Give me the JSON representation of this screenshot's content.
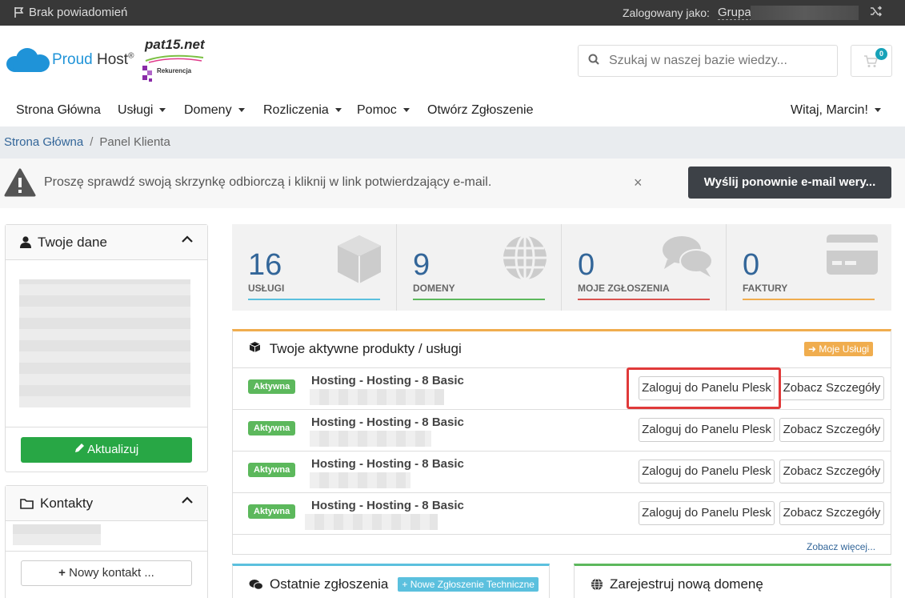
{
  "topbar": {
    "notifications": "Brak powiadomień",
    "logged_as": "Zalogowany jako:",
    "group": "Grupa"
  },
  "header": {
    "brand_a": "Proud",
    "brand_b": "Host",
    "partner_top": "pat15.net",
    "partner_bottom": "Rekurencja",
    "search_placeholder": "Szukaj w naszej bazie wiedzy...",
    "cart_count": "0"
  },
  "nav": {
    "items": [
      {
        "label": "Strona Główna"
      },
      {
        "label": "Usługi"
      },
      {
        "label": "Domeny"
      },
      {
        "label": "Rozliczenia"
      },
      {
        "label": "Pomoc"
      },
      {
        "label": "Otwórz Zgłoszenie"
      }
    ],
    "user": "Witaj, Marcin!"
  },
  "breadcrumb": {
    "home": "Strona Główna",
    "sep": "/",
    "current": "Panel Klienta"
  },
  "alert": {
    "message": "Proszę sprawdź swoją skrzynkę odbiorczą i kliknij w link potwierdzający e-mail.",
    "close": "×",
    "button": "Wyślij ponownie e-mail wery..."
  },
  "sidebar": {
    "yourdata_title": "Twoje dane",
    "update_button": "Aktualizuj",
    "contacts_title": "Kontakty",
    "new_contact_button": "Nowy kontakt ..."
  },
  "stats": [
    {
      "value": "16",
      "label": "USŁUGI",
      "color": "#5bc0de",
      "icon": "cube-icon"
    },
    {
      "value": "9",
      "label": "DOMENY",
      "color": "#5cb85c",
      "icon": "globe-icon"
    },
    {
      "value": "0",
      "label": "MOJE ZGŁOSZENIA",
      "color": "#d9534f",
      "icon": "comments-icon"
    },
    {
      "value": "0",
      "label": "FAKTURY",
      "color": "#f0ad4e",
      "icon": "credit-card-icon"
    }
  ],
  "products": {
    "title": "Twoje aktywne produkty / usługi",
    "my_services": "Moje Usługi",
    "rows": [
      {
        "status": "Aktywna",
        "name": "Hosting - Hosting - 8 Basic",
        "plesk": "Zaloguj do Panelu Plesk",
        "details": "Zobacz Szczegóły"
      },
      {
        "status": "Aktywna",
        "name": "Hosting - Hosting - 8 Basic",
        "plesk": "Zaloguj do Panelu Plesk",
        "details": "Zobacz Szczegóły"
      },
      {
        "status": "Aktywna",
        "name": "Hosting - Hosting - 8 Basic",
        "plesk": "Zaloguj do Panelu Plesk",
        "details": "Zobacz Szczegóły"
      },
      {
        "status": "Aktywna",
        "name": "Hosting - Hosting - 8 Basic",
        "plesk": "Zaloguj do Panelu Plesk",
        "details": "Zobacz Szczegóły"
      }
    ],
    "more": "Zobacz więcej..."
  },
  "tickets": {
    "title": "Ostatnie zgłoszenia",
    "new_button": "Nowe Zgłoszenie Techniczne"
  },
  "domain_register": {
    "title": "Zarejestruj nową domenę"
  }
}
